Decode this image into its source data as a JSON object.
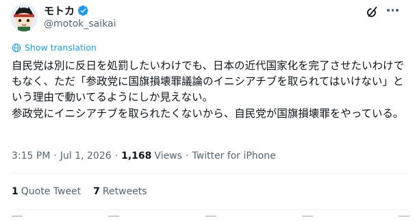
{
  "author": {
    "display_name": "モトカ",
    "handle": "@motok_saikai",
    "verified": true,
    "verified_color": "#1d9bf0"
  },
  "translation": {
    "label": "Show translation",
    "icon": "globe-icon",
    "color": "#1d9bf0"
  },
  "tweet": {
    "text": "自民党は別に反日を処罰したいわけでも、日本の近代国家化を完了させたいわけでもなく、ただ「参政党に国旗損壊罪議論のイニシアチブを取られてはいけない」という理由で動いてるようにしか見えない。\n参政党にイニシアチブを取られたくないから、自民党が国旗損壊罪をやっている。"
  },
  "meta": {
    "time": "3:15 PM",
    "date": "Jul 1, 2026",
    "views_count": "1,168",
    "views_label": "Views",
    "client": "Twitter for iPhone",
    "separator": "·"
  },
  "stats": {
    "quote_count": "1",
    "quote_label": "Quote Tweet",
    "retweet_count": "7",
    "retweet_label": "Retweets"
  },
  "header_icons": [
    "grok-icon",
    "more-icon"
  ],
  "colors": {
    "text": "#0f1419",
    "secondary": "#536471",
    "accent": "#1d9bf0",
    "divider": "#eff3f4"
  }
}
